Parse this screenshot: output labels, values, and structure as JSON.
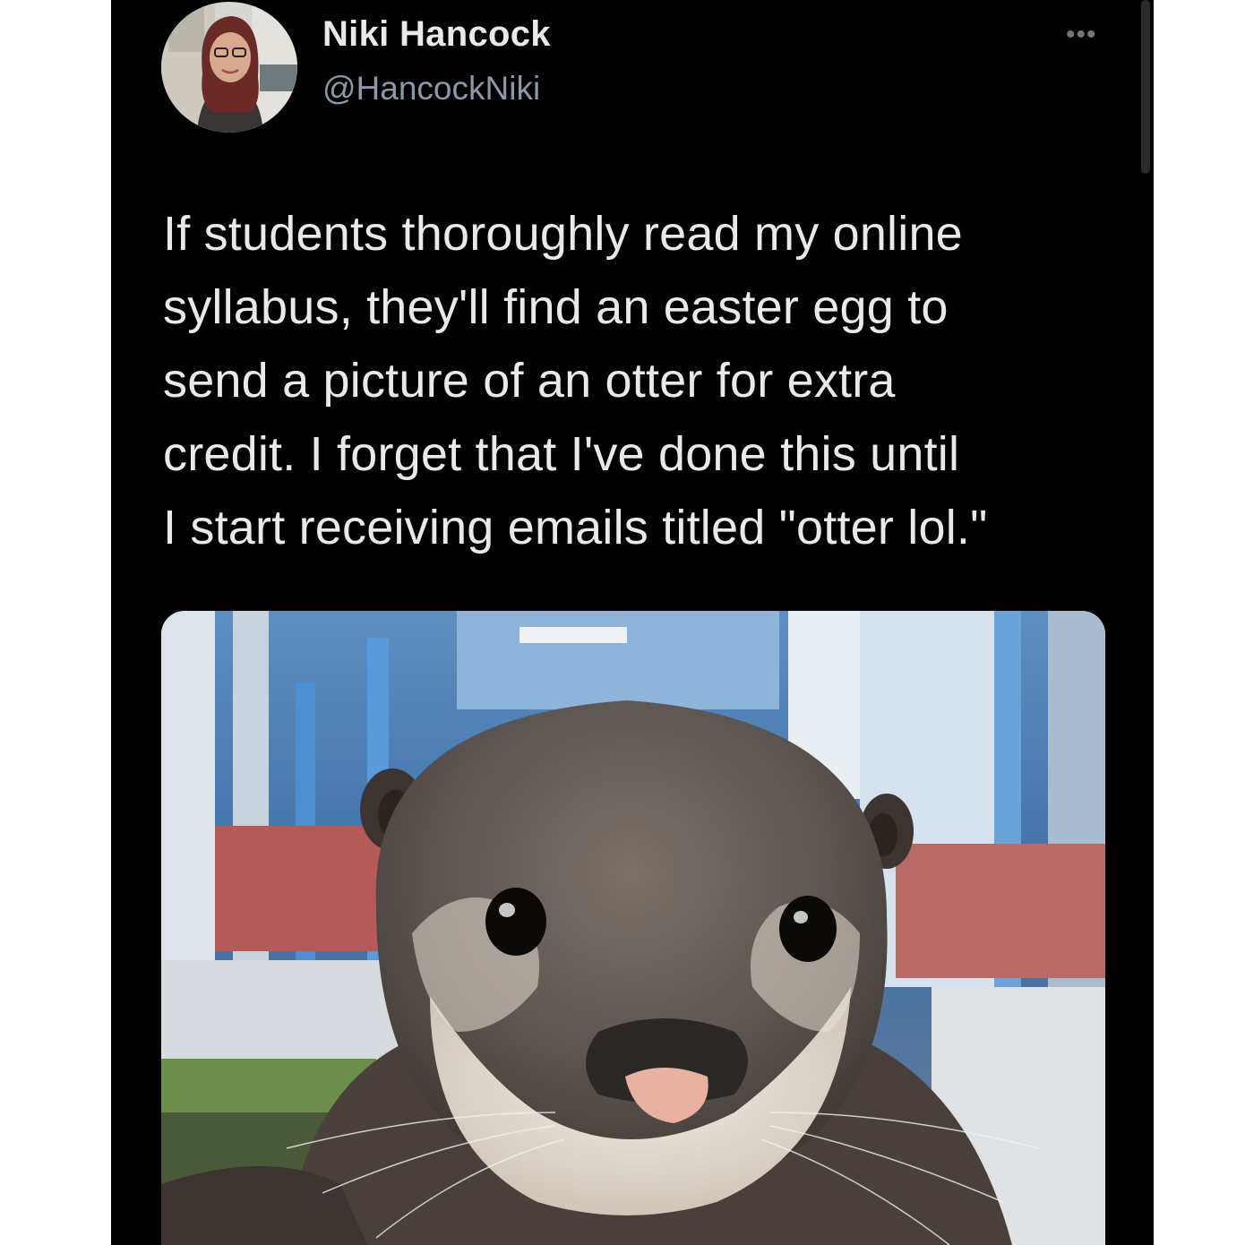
{
  "tweet": {
    "author_name": "Niki Hancock",
    "author_handle": "@HancockNiki",
    "more_icon": "ellipsis-icon",
    "text_lines": [
      "If students thoroughly read my online",
      "syllabus, they'll find an easter egg to",
      "send a picture of an otter for extra",
      "credit. I forget that I've done this until",
      "I start receiving emails titled \"otter lol.\""
    ]
  },
  "colors": {
    "background": "#000000",
    "text_primary": "#e7e9ea",
    "text_secondary": "#8b98a5"
  }
}
